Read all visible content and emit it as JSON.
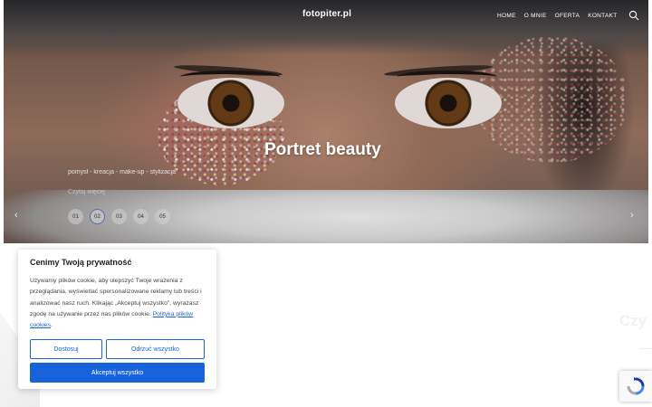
{
  "site": {
    "logo": "fotopiter.pl"
  },
  "nav": {
    "items": [
      "HOME",
      "O MNIE",
      "OFERTA",
      "KONTAKT"
    ]
  },
  "icons": {
    "search": "search-icon",
    "prev": "chevron-left-icon",
    "next": "chevron-right-icon",
    "recaptcha": "recaptcha-logo-icon"
  },
  "slider": {
    "title": "Portret beauty",
    "tags": "pomysł - kreacja - make-up - stylizacja",
    "more": "Czytaj więcej",
    "dots": [
      "01",
      "02",
      "03",
      "04",
      "05"
    ],
    "active_index": 1
  },
  "background": {
    "partial_word": "Czy"
  },
  "cookie": {
    "title": "Cenimy Twoją prywatność",
    "text": "Używamy plików cookie, aby ulepszyć Twoje wrażenia z przeglądania, wyświetlać spersonalizowane reklamy lub treści i analizować nasz ruch. Klikając „Akceptuj wszystko\", wyrażasz zgodę na używanie przez nas plików cookie.",
    "link": "Polityka plików cookies",
    "link_suffix": ".",
    "customize": "Dostosuj",
    "reject": "Odrzuć wszystko",
    "accept": "Akceptuj wszystko"
  },
  "colors": {
    "accent": "#1863dc",
    "dot_active_border": "#5d6fa8"
  }
}
